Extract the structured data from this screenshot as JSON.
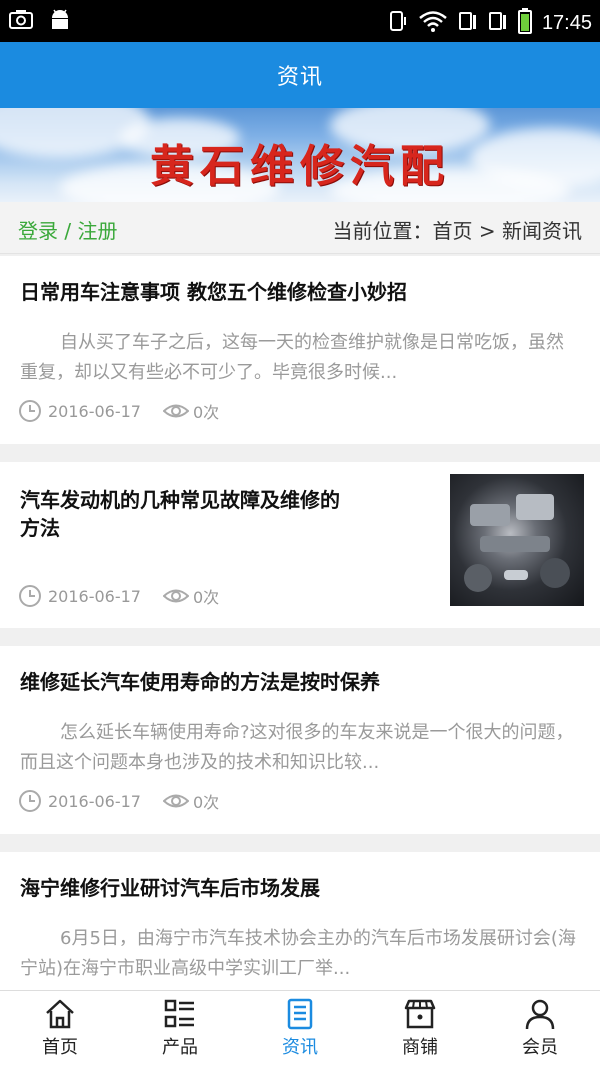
{
  "status_bar": {
    "time": "17:45"
  },
  "header": {
    "title": "资讯"
  },
  "banner": {
    "brand_text": "黄石维修汽配"
  },
  "location": {
    "auth_text": "登录 / 注册",
    "breadcrumb": "当前位置：首页 > 新闻资讯"
  },
  "news": [
    {
      "title": "日常用车注意事项 教您五个维修检查小妙招",
      "summary": "自从买了车子之后，这每一天的检查维护就像是日常吃饭，虽然重复，却以又有些必不可少了。毕竟很多时候...",
      "date": "2016-06-17",
      "views": "0次"
    },
    {
      "title": "汽车发动机的几种常见故障及维修的方法",
      "title_line1": "汽车发动机的几种常见故障及维修的",
      "title_line2": "方法",
      "date": "2016-06-17",
      "views": "0次",
      "thumbnail": "engine-photo"
    },
    {
      "title": "维修延长汽车使用寿命的方法是按时保养",
      "summary": "怎么延长车辆使用寿命?这对很多的车友来说是一个很大的问题，而且这个问题本身也涉及的技术和知识比较...",
      "date": "2016-06-17",
      "views": "0次"
    },
    {
      "title": "海宁维修行业研讨汽车后市场发展",
      "summary": "6月5日，由海宁市汽车技术协会主办的汽车后市场发展研讨会(海宁站)在海宁市职业高级中学实训工厂举..."
    }
  ],
  "tabbar": {
    "items": [
      {
        "label": "首页",
        "icon": "home-icon"
      },
      {
        "label": "产品",
        "icon": "list-icon"
      },
      {
        "label": "资讯",
        "icon": "document-icon",
        "active": true
      },
      {
        "label": "商铺",
        "icon": "store-icon"
      },
      {
        "label": "会员",
        "icon": "user-icon"
      }
    ]
  },
  "colors": {
    "accent": "#1b8be0",
    "auth_green": "#3aa83a",
    "brand_red": "#d7261d"
  }
}
